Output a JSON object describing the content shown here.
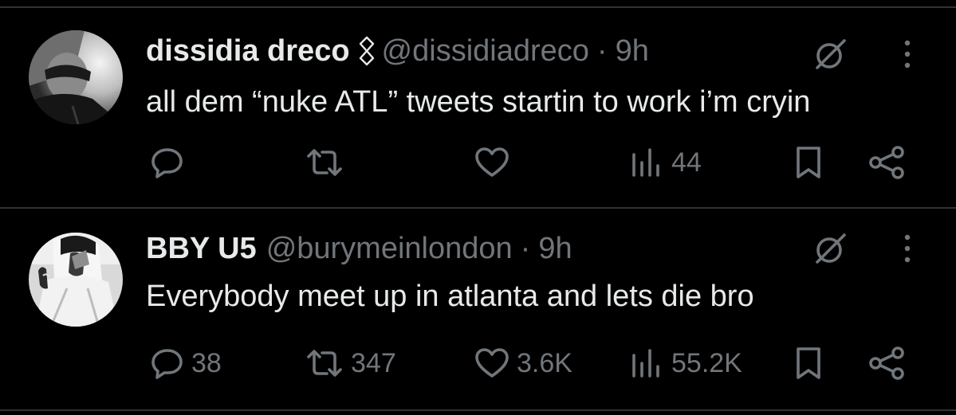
{
  "colors": {
    "background": "#000000",
    "text_primary": "#e7e9ea",
    "text_secondary": "#71767b",
    "divider": "#2f3336"
  },
  "tweets": [
    {
      "display_name": "dissidia dreco",
      "affiliation_icon": "custom-badge-icon",
      "handle": "@dissidiadreco",
      "separator": "·",
      "time": "9h",
      "text": "all dem “nuke ATL” tweets startin to work i’m cryin",
      "metrics": {
        "replies": "",
        "retweets": "",
        "likes": "",
        "views": "44"
      }
    },
    {
      "display_name": "BBY U5",
      "handle": "@burymeinlondon",
      "separator": "·",
      "time": "9h",
      "text": "Everybody meet up in atlanta and lets die bro",
      "metrics": {
        "replies": "38",
        "retweets": "347",
        "likes": "3.6K",
        "views": "55.2K"
      }
    }
  ]
}
